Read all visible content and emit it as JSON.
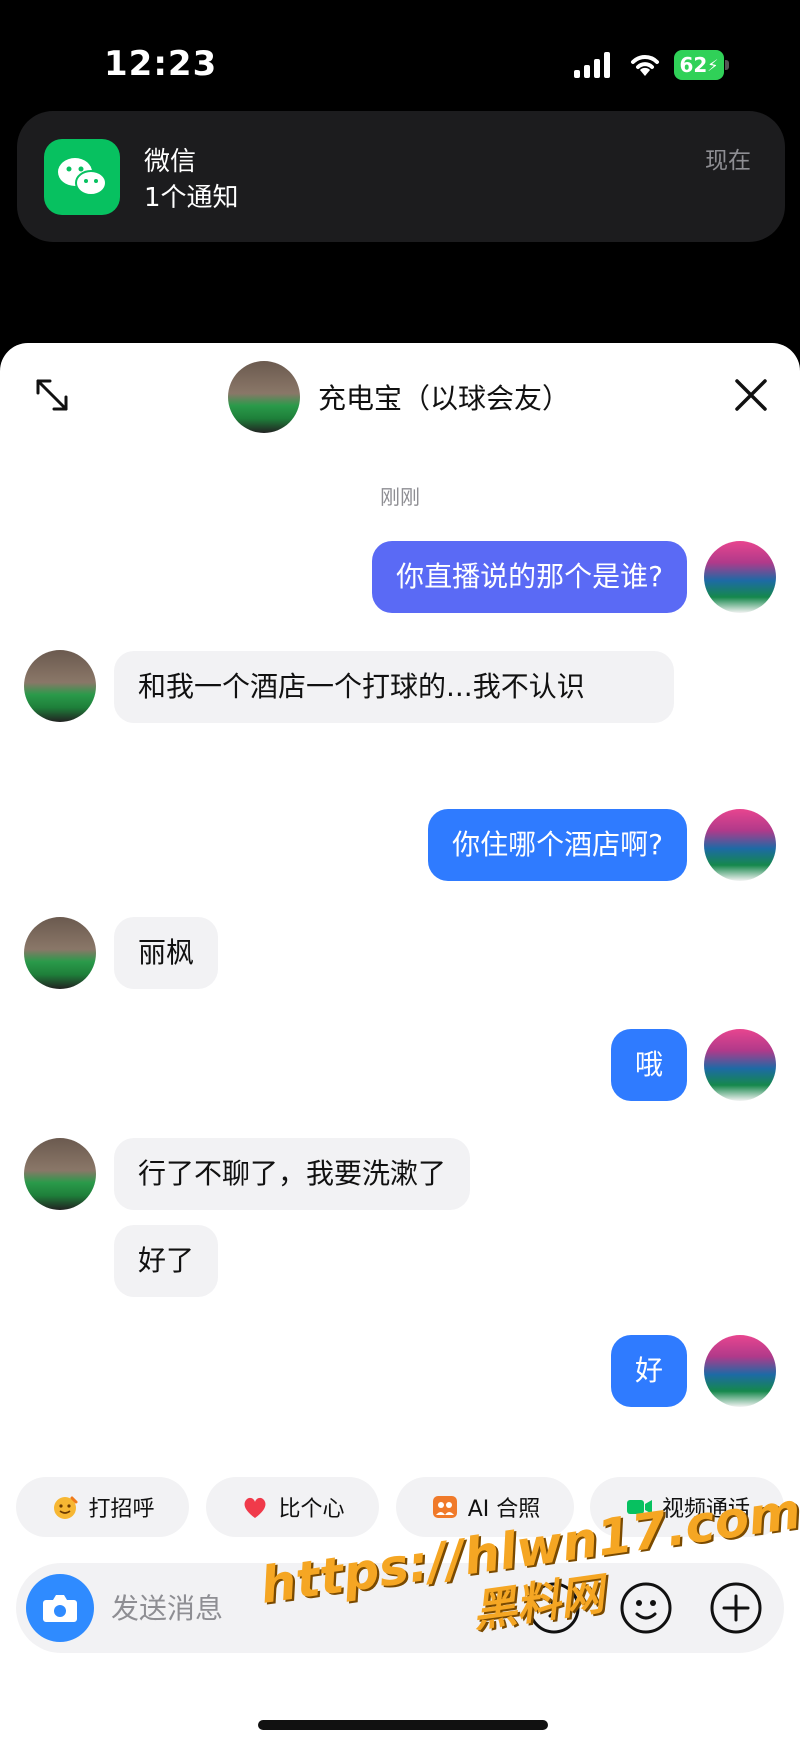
{
  "status_bar": {
    "time": "12:23",
    "battery": "62"
  },
  "notification": {
    "app": "微信",
    "body": "1个通知",
    "time": "现在"
  },
  "chat": {
    "title": "充电宝（以球会友）",
    "time_label": "刚刚",
    "messages": [
      {
        "from": "me",
        "text": "你直播说的那个是谁?"
      },
      {
        "from": "friend",
        "text": "和我一个酒店一个打球的...我不认识"
      },
      {
        "from": "me",
        "text": "你住哪个酒店啊?"
      },
      {
        "from": "friend",
        "text": "丽枫"
      },
      {
        "from": "me",
        "text": "哦"
      },
      {
        "from": "friend",
        "text": "行了不聊了，我要洗漱了"
      },
      {
        "from": "friend",
        "text": "好了"
      },
      {
        "from": "me",
        "text": "好"
      }
    ]
  },
  "quick_actions": [
    {
      "label": "打招呼",
      "icon": "wave-emoji-icon"
    },
    {
      "label": "比个心",
      "icon": "heart-icon"
    },
    {
      "label": "AI 合照",
      "icon": "ai-photo-icon"
    },
    {
      "label": "视频通话",
      "icon": "video-call-icon"
    }
  ],
  "input": {
    "placeholder": "发送消息"
  },
  "watermark": {
    "line1": "https://hlwn17.com",
    "line2": "黑料网"
  },
  "colors": {
    "accent": "#2f7bff",
    "wechat_green": "#07c160",
    "bubble_gray": "#f2f2f4"
  }
}
